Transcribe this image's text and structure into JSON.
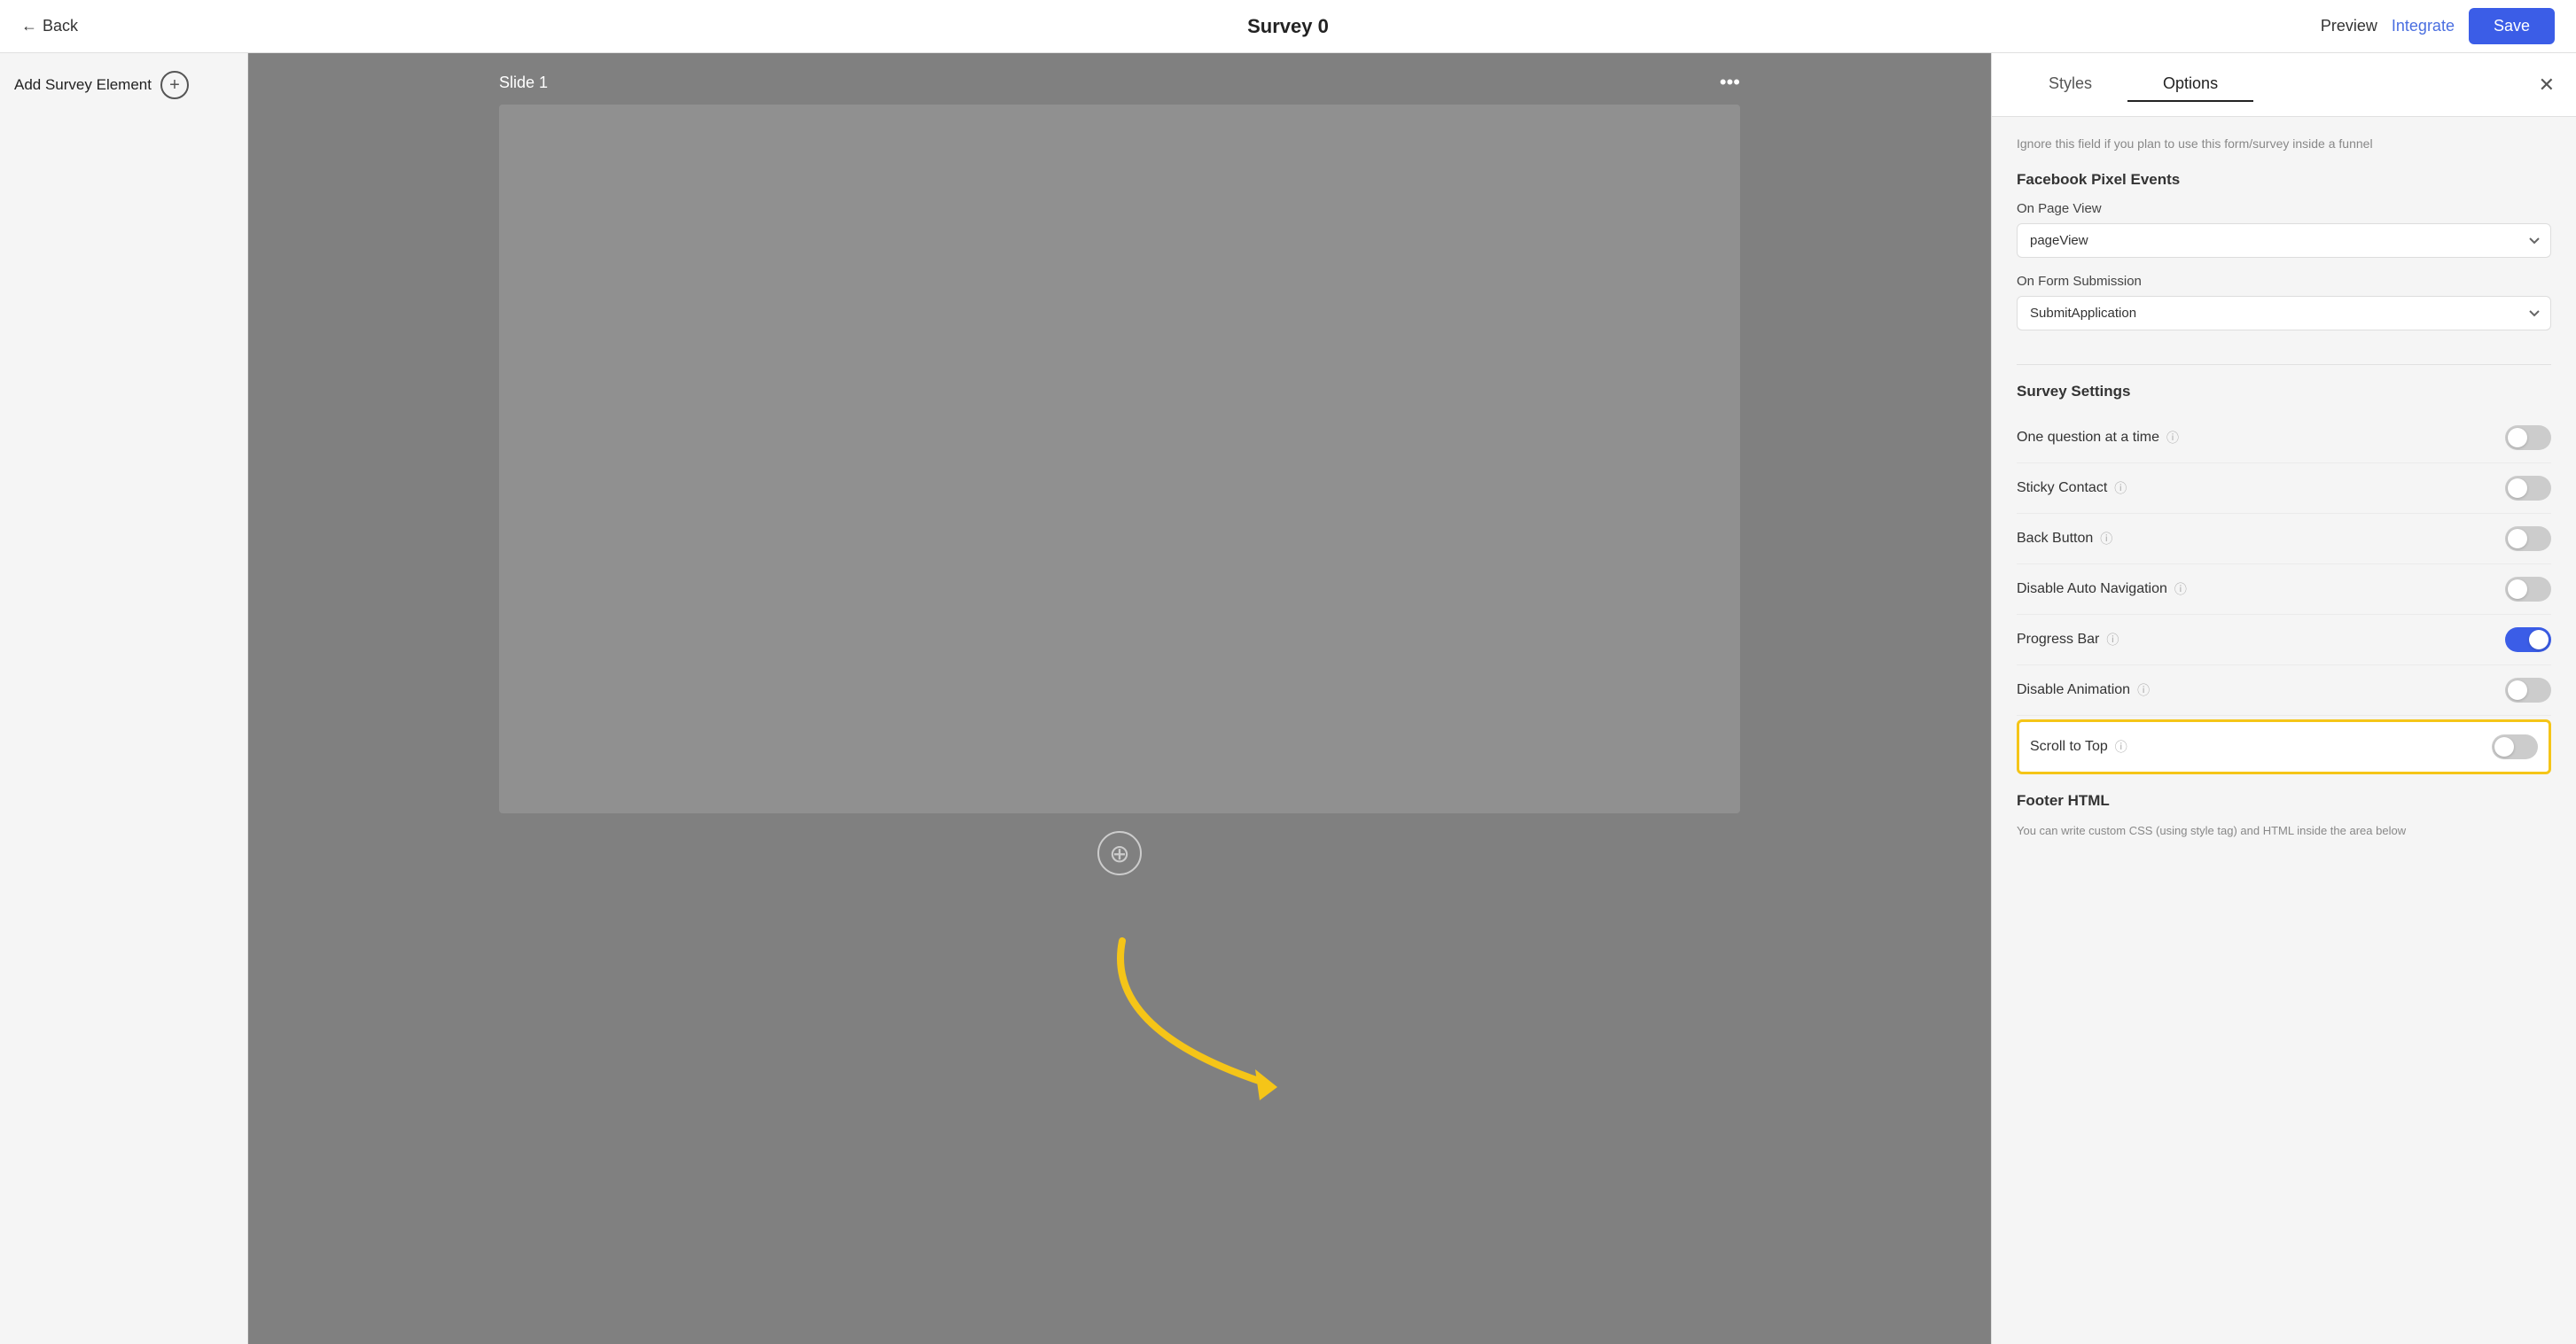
{
  "header": {
    "back_label": "Back",
    "title": "Survey 0",
    "preview_label": "Preview",
    "integrate_label": "Integrate",
    "save_label": "Save"
  },
  "left_sidebar": {
    "add_element_label": "Add Survey Element",
    "add_icon": "+"
  },
  "canvas": {
    "slide_title": "Slide 1",
    "slide_menu_icon": "•••",
    "add_slide_icon": "⊕"
  },
  "right_panel": {
    "close_icon": "×",
    "tabs": [
      {
        "label": "Styles",
        "active": false
      },
      {
        "label": "Options",
        "active": true
      }
    ],
    "note_text": "Ignore this field if you plan to use this form/survey inside a funnel",
    "facebook_pixel": {
      "section_label": "Facebook Pixel Events",
      "on_page_view_label": "On Page View",
      "on_page_view_value": "pageView",
      "on_form_submission_label": "On Form Submission",
      "on_form_submission_value": "SubmitApplication"
    },
    "survey_settings": {
      "section_label": "Survey Settings",
      "toggles": [
        {
          "label": "One question at a time",
          "info": true,
          "on": false,
          "name": "one-question"
        },
        {
          "label": "Sticky Contact",
          "info": true,
          "on": false,
          "name": "sticky-contact"
        },
        {
          "label": "Back Button",
          "info": true,
          "on": false,
          "name": "back-button"
        },
        {
          "label": "Disable Auto Navigation",
          "info": true,
          "on": false,
          "name": "disable-auto-nav"
        },
        {
          "label": "Progress Bar",
          "info": true,
          "on": true,
          "name": "progress-bar"
        },
        {
          "label": "Disable Animation",
          "info": true,
          "on": false,
          "name": "disable-animation"
        },
        {
          "label": "Scroll to Top",
          "info": true,
          "on": false,
          "name": "scroll-to-top",
          "highlighted": true
        }
      ]
    },
    "footer_html": {
      "section_label": "Footer HTML",
      "note": "You can write custom CSS (using style tag) and HTML inside the area below"
    }
  }
}
